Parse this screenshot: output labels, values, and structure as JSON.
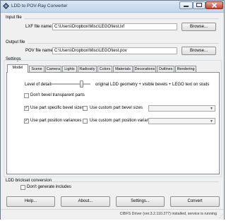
{
  "window": {
    "title": "LDD to POV-Ray Converter"
  },
  "input_file": {
    "section_label": "Input file",
    "field_label": "LXF file name:",
    "value": "C:\\Users\\Dropbox\\Misc\\LEGO\\test.lxf",
    "browse_label": "Browse..."
  },
  "output_file": {
    "section_label": "Output file",
    "field_label": "POV file name:",
    "value": "C:\\Users\\Dropbox\\Misc\\LEGO\\test.pov",
    "browse_label": "Browse..."
  },
  "settings": {
    "section_label": "Settings",
    "tabs": [
      "Model",
      "Scene",
      "Camera",
      "Lights",
      "Radiosity",
      "Colors",
      "Materials",
      "Decorations",
      "Outlines",
      "Rendering"
    ],
    "active_tab": "Model",
    "model": {
      "level_of_detail_label": "Level of detail:",
      "level_of_detail_value": "original LDD geometry + visible bevels + LEGO text on studs",
      "dont_bevel_transparent_label": "Don't bevel transparent parts",
      "dont_bevel_transparent_checked": false,
      "use_part_specific_bevel_label": "Use part specific bevel sizes",
      "use_part_specific_bevel_checked": true,
      "use_custom_bevel_label": "Use custom part bevel sizes",
      "use_custom_bevel_checked": false,
      "custom_bevel_select": "",
      "use_part_position_label": "Use part position variances",
      "use_part_position_checked": true,
      "use_custom_position_label": "Use custom part position variances",
      "use_custom_position_checked": false,
      "custom_position_select": ""
    }
  },
  "brickset": {
    "section_label": "LDD brickset conversion",
    "dont_generate_label": "Don't generate includes",
    "dont_generate_checked": false
  },
  "buttons": {
    "help": "Help...",
    "about": "About...",
    "settings": "Settings...",
    "convert": "Convert"
  },
  "status": {
    "text": "CIBFS Driver (ver.3.2.110.277) installed, service is running"
  }
}
